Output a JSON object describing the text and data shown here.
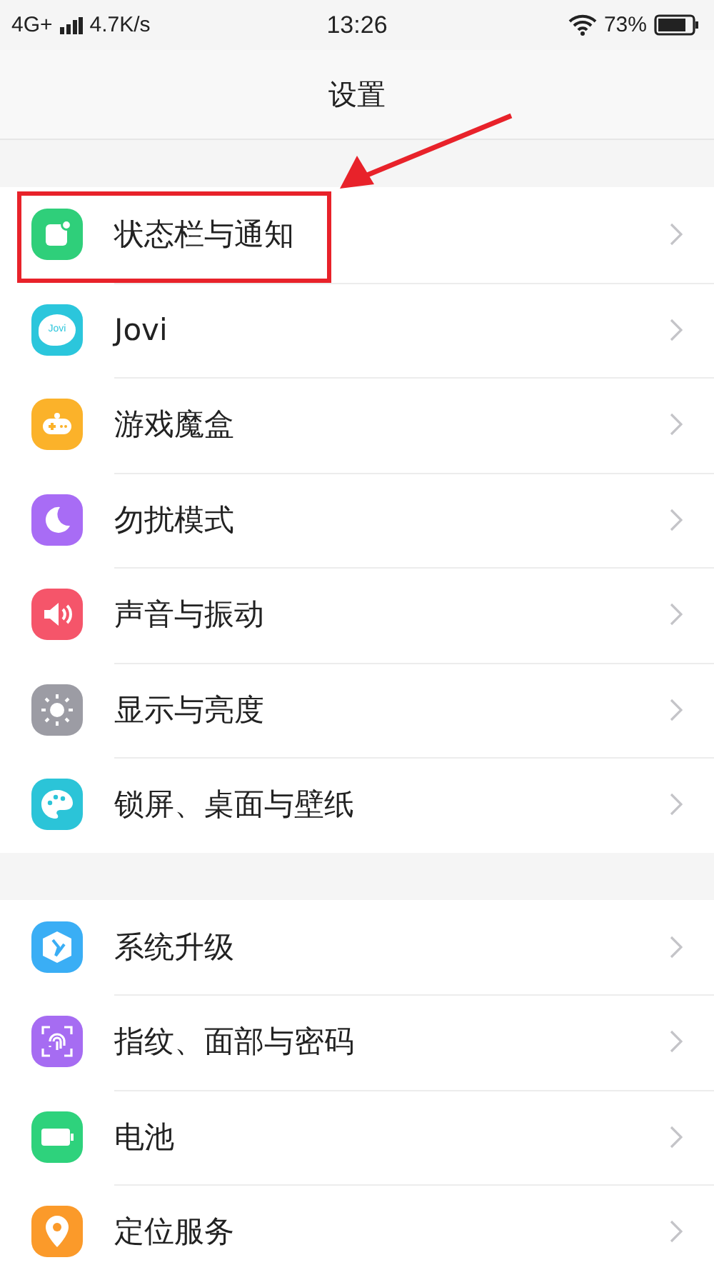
{
  "status_bar": {
    "network": "4G+",
    "speed": "4.7K/s",
    "time": "13:26",
    "battery": "73%"
  },
  "title": "设置",
  "groups": [
    {
      "items": [
        {
          "label": "状态栏与通知",
          "kind": "status",
          "highlighted": true
        },
        {
          "label": "Jovi",
          "kind": "jovi",
          "icon_text": "Jovi",
          "highlighted": false
        },
        {
          "label": "游戏魔盒",
          "kind": "game",
          "highlighted": false
        },
        {
          "label": "勿扰模式",
          "kind": "moon",
          "highlighted": false
        },
        {
          "label": "声音与振动",
          "kind": "sound",
          "highlighted": false
        },
        {
          "label": "显示与亮度",
          "kind": "sun",
          "highlighted": false
        },
        {
          "label": "锁屏、桌面与壁纸",
          "kind": "palette",
          "highlighted": false
        }
      ]
    },
    {
      "items": [
        {
          "label": "系统升级",
          "kind": "update",
          "highlighted": false
        },
        {
          "label": "指纹、面部与密码",
          "kind": "finger",
          "highlighted": false
        },
        {
          "label": "电池",
          "kind": "battery",
          "highlighted": false
        },
        {
          "label": "定位服务",
          "kind": "location",
          "highlighted": false
        }
      ]
    }
  ]
}
